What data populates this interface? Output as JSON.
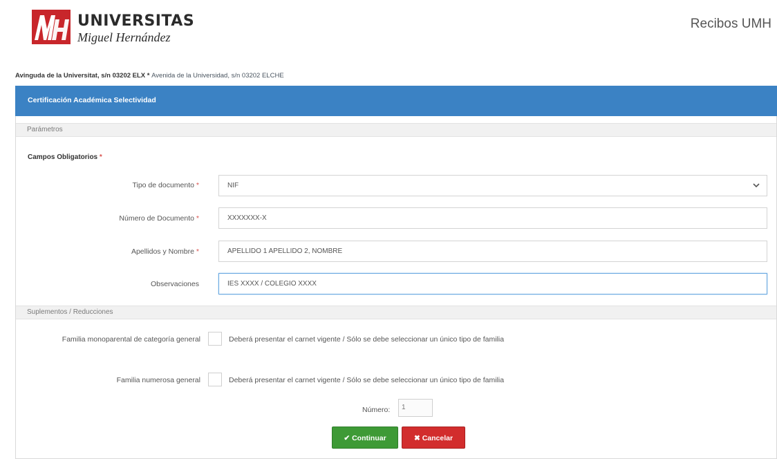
{
  "header": {
    "logo_mark_text": "MH",
    "logo_line1": "UNIVERSITAS",
    "logo_line2": "Miguel Hernández",
    "app_title": "Recibos UMH",
    "address_bold": "Avinguda de la Universitat, s/n 03202 ELX",
    "address_sep": " * ",
    "address_rest": "Avenida de la Universidad, s/n 03202 ELCHE"
  },
  "panel": {
    "title": "Certificación Académica Selectividad",
    "section_params": "Parámetros",
    "required_title": "Campos Obligatorios",
    "required_star": "*",
    "fields": [
      {
        "label": "Tipo de documento",
        "star": "*",
        "value": "NIF",
        "type": "select"
      },
      {
        "label": "Número de Documento",
        "star": "*",
        "value": "XXXXXXX-X",
        "type": "text"
      },
      {
        "label": "Apellidos y Nombre",
        "star": "*",
        "value": "APELLIDO 1 APELLIDO 2, NOMBRE",
        "type": "text"
      },
      {
        "label": "Observaciones",
        "star": "",
        "value": "IES XXXX / COLEGIO XXXX",
        "type": "text"
      }
    ],
    "section_supplements": "Suplementos / Reducciones",
    "checkboxes": [
      {
        "label": "Familia monoparental de categoría general",
        "note": "Deberá presentar el carnet vigente / Sólo se debe seleccionar un único tipo de familia",
        "checked": false
      },
      {
        "label": "Familia numerosa general",
        "note": "Deberá presentar el carnet vigente / Sólo se debe seleccionar un único tipo de familia",
        "checked": false
      }
    ],
    "numero_label": "Número:",
    "numero_value": "1"
  },
  "buttons": {
    "continue_icon": "✔",
    "continue_label": "Continuar",
    "cancel_icon": "✖",
    "cancel_label": "Cancelar"
  },
  "icons": {
    "select_chevron": "chevron-down-icon",
    "continue": "check-icon",
    "cancel": "close-icon"
  },
  "colors": {
    "panel_header": "#3b82c4",
    "logo_red": "#c8262b",
    "continue_green": "#3e9a36",
    "cancel_red": "#d22d2d",
    "required_star": "#d9534f"
  }
}
